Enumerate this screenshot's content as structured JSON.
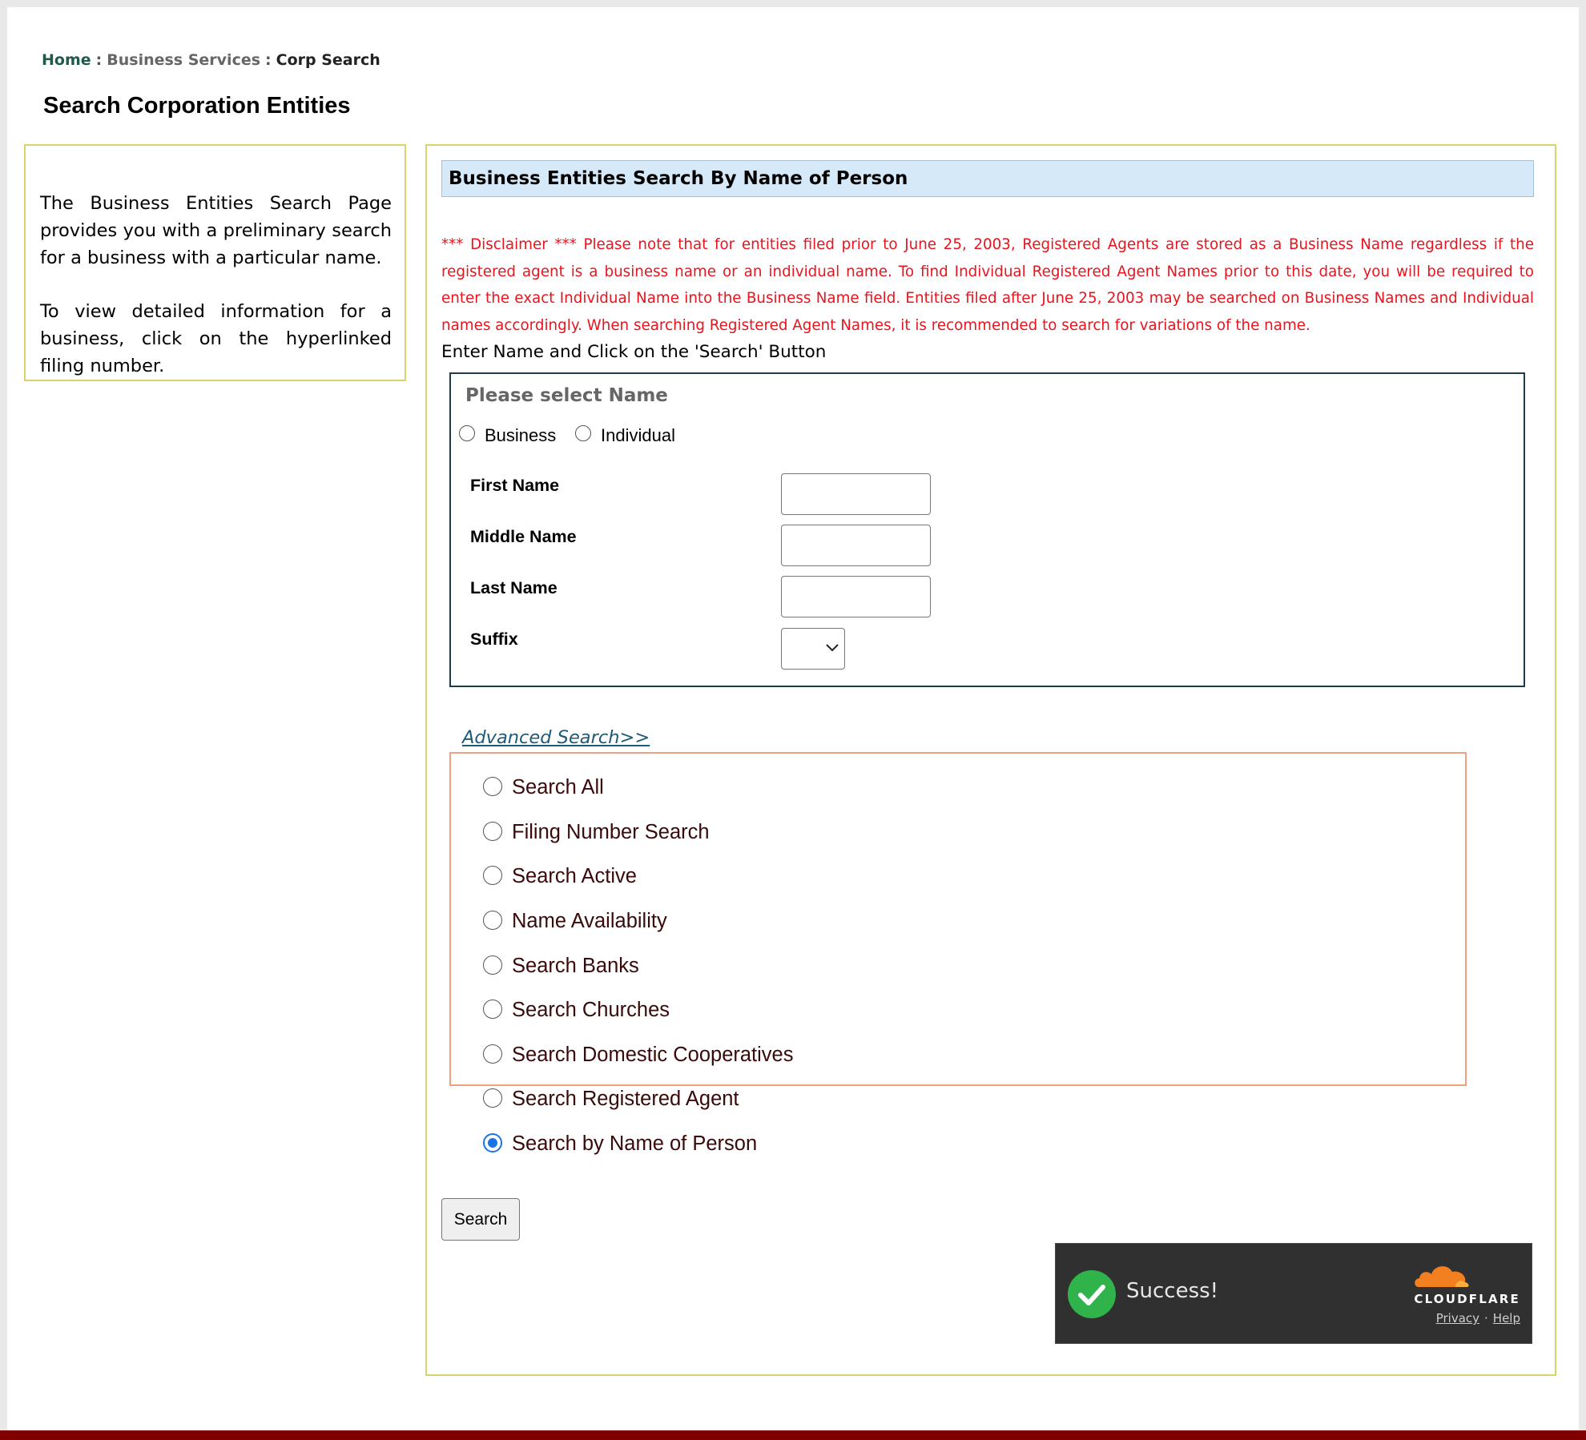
{
  "breadcrumb": {
    "home": "Home",
    "separator": ":",
    "services": "Business Services",
    "current": "Corp Search"
  },
  "page_title": "Search Corporation Entities",
  "sidebar": {
    "paragraph1": "The Business Entities Search Page provides you with a preliminary search for a business with a particular name.",
    "paragraph2": "To view detailed information for a business, click on the hyperlinked filing number."
  },
  "main": {
    "section_title": "Business Entities Search By Name of Person",
    "disclaimer": "*** Disclaimer *** Please note that for entities filed prior to June 25, 2003, Registered Agents are stored as a Business Name regardless if the registered agent is a business name or an individual name. To find Individual Registered Agent Names prior to this date, you will be required to enter the exact Individual Name into the Business Name field. Entities filed after June 25, 2003 may be searched on Business Names and Individual names accordingly. When searching Registered Agent Names, it is recommended to search for variations of the name.",
    "instruction": "Enter Name and Click on the 'Search' Button"
  },
  "name_form": {
    "legend": "Please select Name",
    "type_options": [
      {
        "label": "Business",
        "checked": false
      },
      {
        "label": "Individual",
        "checked": false
      }
    ],
    "first_name_label": "First Name",
    "first_name_value": "",
    "middle_name_label": "Middle Name",
    "middle_name_value": "",
    "last_name_label": "Last Name",
    "last_name_value": "",
    "suffix_label": "Suffix",
    "suffix_value": ""
  },
  "advanced": {
    "link_label": "Advanced Search>>",
    "options": [
      {
        "label": "Search All",
        "checked": false
      },
      {
        "label": "Filing Number Search",
        "checked": false
      },
      {
        "label": "Search Active",
        "checked": false
      },
      {
        "label": "Name Availability",
        "checked": false
      },
      {
        "label": "Search Banks",
        "checked": false
      },
      {
        "label": "Search Churches",
        "checked": false
      },
      {
        "label": "Search Domestic Cooperatives",
        "checked": false
      },
      {
        "label": "Search Registered Agent",
        "checked": false
      },
      {
        "label": "Search by Name of Person",
        "checked": true
      }
    ]
  },
  "search_button_label": "Search",
  "captcha": {
    "status": "Success!",
    "brand": "CLOUDFLARE",
    "privacy_label": "Privacy",
    "separator": "·",
    "help_label": "Help",
    "check_color": "#2fb34a",
    "logo_color": "#f38020"
  },
  "colors": {
    "footer_bar": "#800000",
    "disclaimer": "#e8141e",
    "header_bg": "#d6e9f8"
  }
}
